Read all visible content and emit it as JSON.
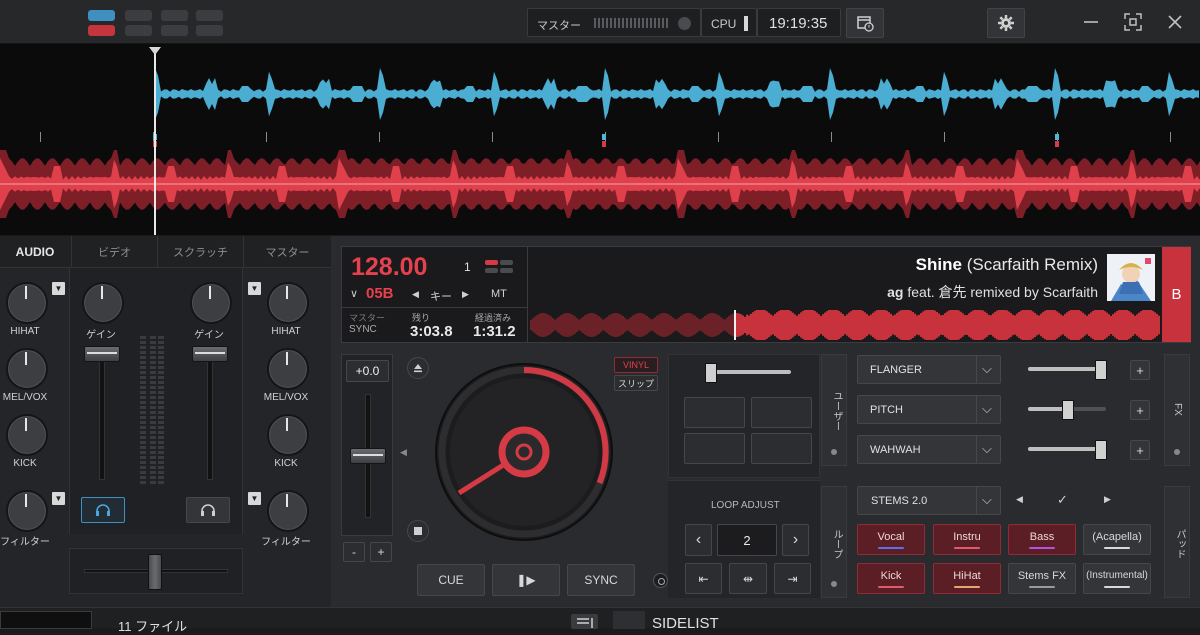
{
  "topbar": {
    "master_label": "マスター",
    "cpu_label": "CPU",
    "clock": "19:19:35",
    "icons": [
      "calendar-clock-icon",
      "gear-icon",
      "minimize-icon",
      "fullscreen-icon",
      "close-icon"
    ]
  },
  "mixer": {
    "tabs": [
      "AUDIO",
      "ビデオ",
      "スクラッチ",
      "マスター"
    ],
    "eq_labels": [
      "HIHAT",
      "MEL/VOX",
      "KICK",
      "フィルター"
    ],
    "gain_label": "ゲイン"
  },
  "deck": {
    "bpm": "128.00",
    "key": "05B",
    "key_label": "キー",
    "deck_number": "1",
    "mt_label": "MT",
    "title": "Shine",
    "remix": "(Scarfaith Remix)",
    "artist": "ag",
    "feat": "feat. 倉先 remixed by Scarfaith",
    "deck_letter": "B",
    "sync_header": "マスター",
    "sync_label": "SYNC",
    "remaining_label": "残り",
    "remaining": "3:03.8",
    "elapsed_label": "経過済み",
    "elapsed": "1:31.2",
    "pitch": "+0.0",
    "vinyl_label": "VINYL",
    "slip_label": "スリップ",
    "cue": "CUE",
    "play": "❚▶",
    "sync": "SYNC",
    "minus": "-",
    "plus": "+"
  },
  "user_panel": {
    "label": "ユーザー"
  },
  "fx": {
    "label": "FX",
    "effects": [
      {
        "name": "FLANGER",
        "level": 0.92
      },
      {
        "name": "PITCH",
        "level": 0.5
      },
      {
        "name": "WAHWAH",
        "level": 0.92
      }
    ],
    "add": "+"
  },
  "loop": {
    "title": "LOOP ADJUST",
    "value": "2",
    "side_label": "ループ"
  },
  "stems": {
    "select": "STEMS 2.0",
    "pads_label": "パッド",
    "buttons": [
      {
        "label": "Vocal",
        "color": "#5e6ee8"
      },
      {
        "label": "Instru",
        "color": "#e05a6a"
      },
      {
        "label": "Bass",
        "color": "#b84fe0"
      },
      {
        "label": "(Acapella)",
        "color": "#d8d8d8"
      },
      {
        "label": "Kick",
        "color": "#e05a6a"
      },
      {
        "label": "HiHat",
        "color": "#e8a36e"
      },
      {
        "label": "Stems FX",
        "color": "#9a9a9a"
      },
      {
        "label": "(Instrumental)",
        "color": "#d8d8d8"
      }
    ]
  },
  "browser": {
    "files": "11 ファイル",
    "sidelist": "SIDELIST"
  },
  "colors": {
    "deck_a_wave": "#4fb6dc",
    "deck_b_wave": "#e0404c",
    "accent_red": "#d63a44"
  }
}
